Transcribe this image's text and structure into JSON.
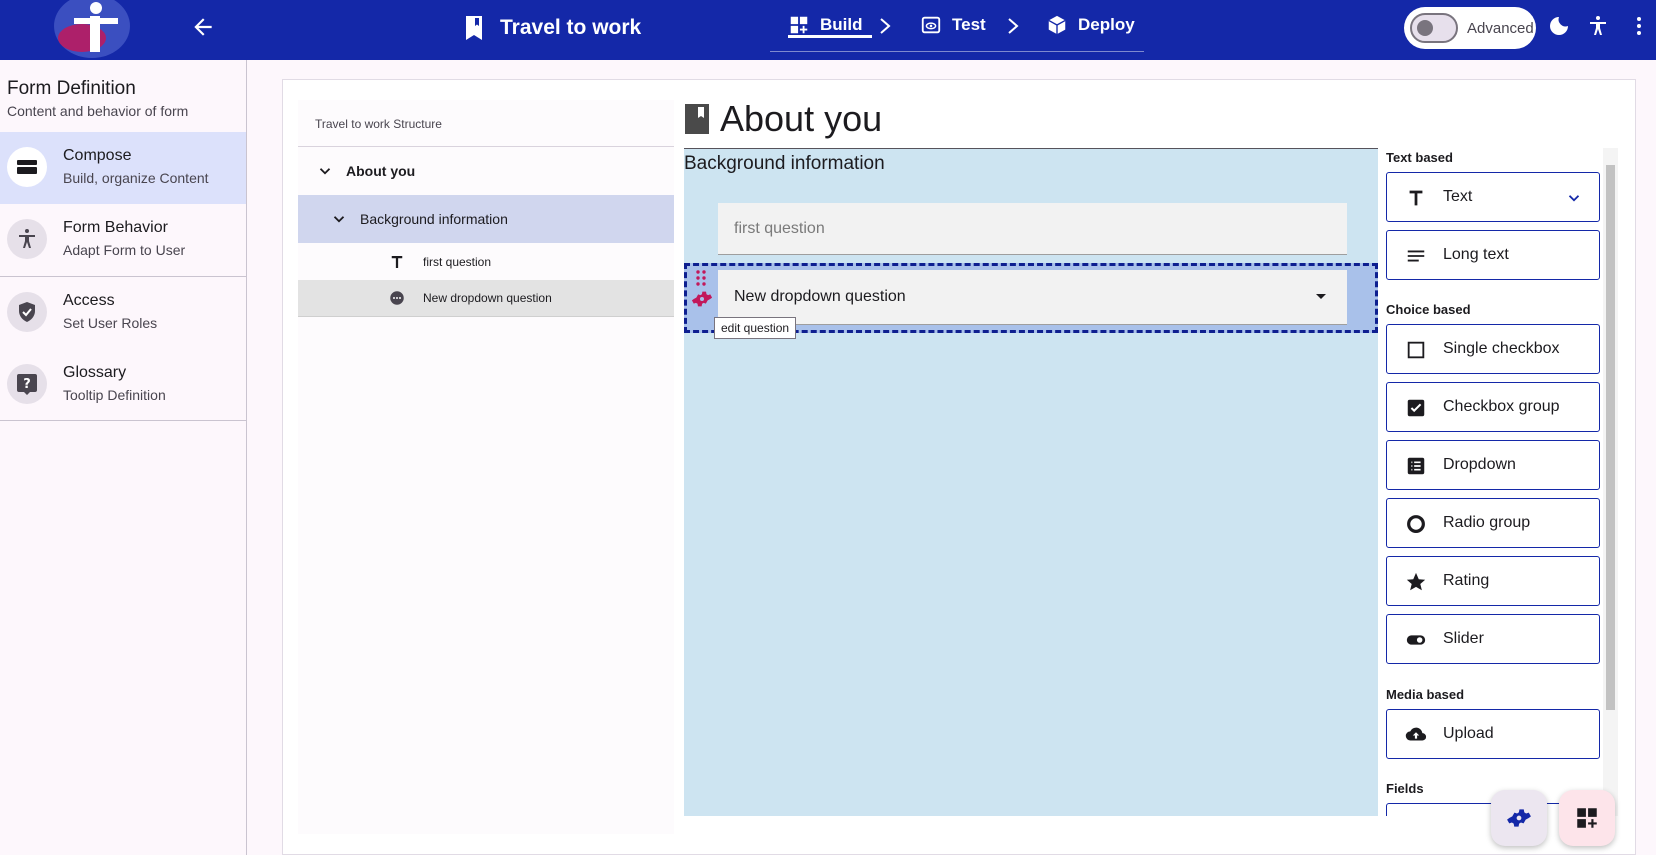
{
  "header": {
    "form_title": "Travel to work",
    "steps": [
      {
        "label": "Build",
        "active": true
      },
      {
        "label": "Test",
        "active": false
      },
      {
        "label": "Deploy",
        "active": false
      }
    ],
    "advanced_label": "Advanced",
    "advanced_on": false
  },
  "sidebar": {
    "title": "Form Definition",
    "subtitle": "Content and behavior of form",
    "items": [
      {
        "label": "Compose",
        "sub": "Build, organize Content",
        "icon": "compose-icon",
        "active": true
      },
      {
        "label": "Form Behavior",
        "sub": "Adapt Form to User",
        "icon": "accessibility-icon",
        "active": false
      },
      {
        "label": "Access",
        "sub": "Set User Roles",
        "icon": "shield-icon",
        "active": false
      },
      {
        "label": "Glossary",
        "sub": "Tooltip Definition",
        "icon": "help-icon",
        "active": false
      }
    ]
  },
  "tree": {
    "heading": "Travel to work Structure",
    "nodes": [
      {
        "label": "About you"
      },
      {
        "label": "Background information"
      },
      {
        "label": "first question"
      },
      {
        "label": "New dropdown question"
      }
    ]
  },
  "canvas": {
    "page_title": "About you",
    "section_title": "Background information",
    "first_field_placeholder": "first question",
    "dropdown_label": "New dropdown question",
    "tooltip": "edit question"
  },
  "palette": {
    "groups": {
      "text": "Text based",
      "choice": "Choice based",
      "media": "Media based",
      "fields": "Fields"
    },
    "items": {
      "text": "Text",
      "long_text": "Long text",
      "single_checkbox": "Single checkbox",
      "checkbox_group": "Checkbox group",
      "dropdown": "Dropdown",
      "radio_group": "Radio group",
      "rating": "Rating",
      "slider": "Slider",
      "upload": "Upload"
    }
  },
  "colors": {
    "brand": "#1428a8",
    "accent": "#c2185b",
    "canvas_bg": "#cde4f1",
    "selected": "#a9c1ea"
  }
}
